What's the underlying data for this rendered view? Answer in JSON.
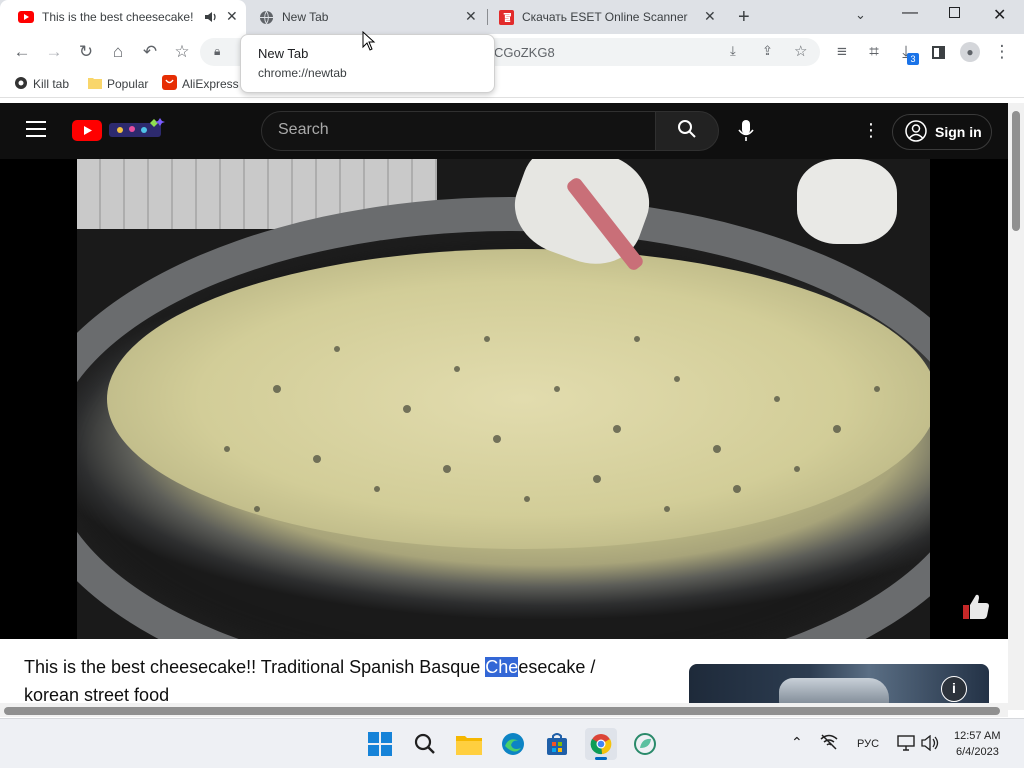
{
  "tabs": [
    {
      "title": "This is the best cheesecake!! Traditional Spanish Basque Cheesecake / korean street food",
      "audio": true,
      "active": true
    },
    {
      "title": "New Tab",
      "active": false
    },
    {
      "title": "Скачать ESET Online Scanner",
      "active": false
    }
  ],
  "omnibox": {
    "url_fragment": "CGoZKG8"
  },
  "downloads_badge": "3",
  "bookmarks": [
    "Kill tab",
    "Popular",
    "AliExpress"
  ],
  "tooltip": {
    "title": "New Tab",
    "url": "chrome://newtab"
  },
  "youtube": {
    "search_placeholder": "Search",
    "signin_label": "Sign in",
    "video_title_before": "This is the best cheesecake!! Traditional Spanish Basque ",
    "video_title_highlight": "Che",
    "video_title_after": "esecake / korean street food"
  },
  "taskbar": {
    "language": "РУС",
    "time": "12:57 AM",
    "date": "6/4/2023"
  },
  "colors": {
    "youtube_red": "#ff0000",
    "highlight": "#3367d6",
    "tab_strip": "#dee1e6"
  }
}
